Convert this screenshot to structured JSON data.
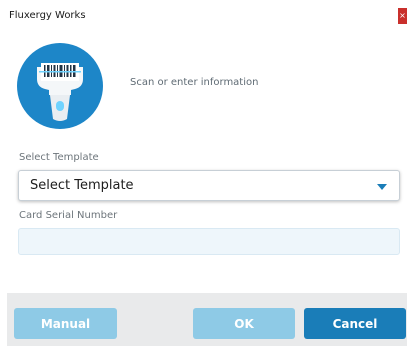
{
  "window": {
    "title": "Fluxergy Works",
    "close_glyph": "×"
  },
  "header": {
    "icon": "barcode-scanner-icon",
    "instruction": "Scan or enter information"
  },
  "form": {
    "template": {
      "label": "Select Template",
      "selected": "Select Template"
    },
    "serial": {
      "label": "Card Serial Number",
      "value": ""
    }
  },
  "footer": {
    "manual_label": "Manual",
    "ok_label": "OK",
    "cancel_label": "Cancel"
  },
  "colors": {
    "primary": "#1a7db8",
    "primary_disabled": "#8ecae6",
    "close": "#c9302c",
    "logo_circle": "#1d86c8"
  }
}
